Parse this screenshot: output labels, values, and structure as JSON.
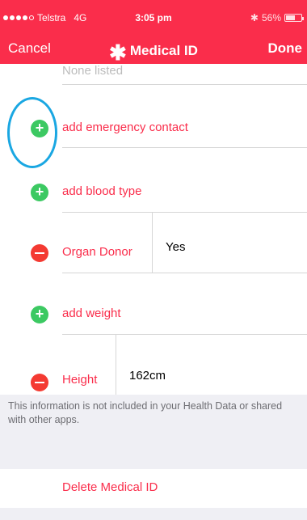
{
  "status_bar": {
    "carrier": "Telstra",
    "network": "4G",
    "time": "3:05 pm",
    "battery_text": "56%",
    "battery_level": 0.56,
    "bluetooth_icon": "bluetooth-icon"
  },
  "nav": {
    "cancel": "Cancel",
    "title": "Medical ID",
    "title_icon": "asterisk-icon",
    "done": "Done"
  },
  "rows": {
    "none_listed": "None listed",
    "emergency_contact": "add emergency contact",
    "blood_type": "add blood type",
    "organ_donor_label": "Organ Donor",
    "organ_donor_value": "Yes",
    "weight": "add weight",
    "height_label": "Height",
    "height_value": "162cm"
  },
  "footer": {
    "note": "This information is not included in your Health Data or shared with other apps.",
    "delete": "Delete Medical ID"
  },
  "colors": {
    "accent": "#fa2d4b",
    "add": "#3cc962",
    "remove": "#f43a32",
    "highlight": "#1aa7e2"
  }
}
